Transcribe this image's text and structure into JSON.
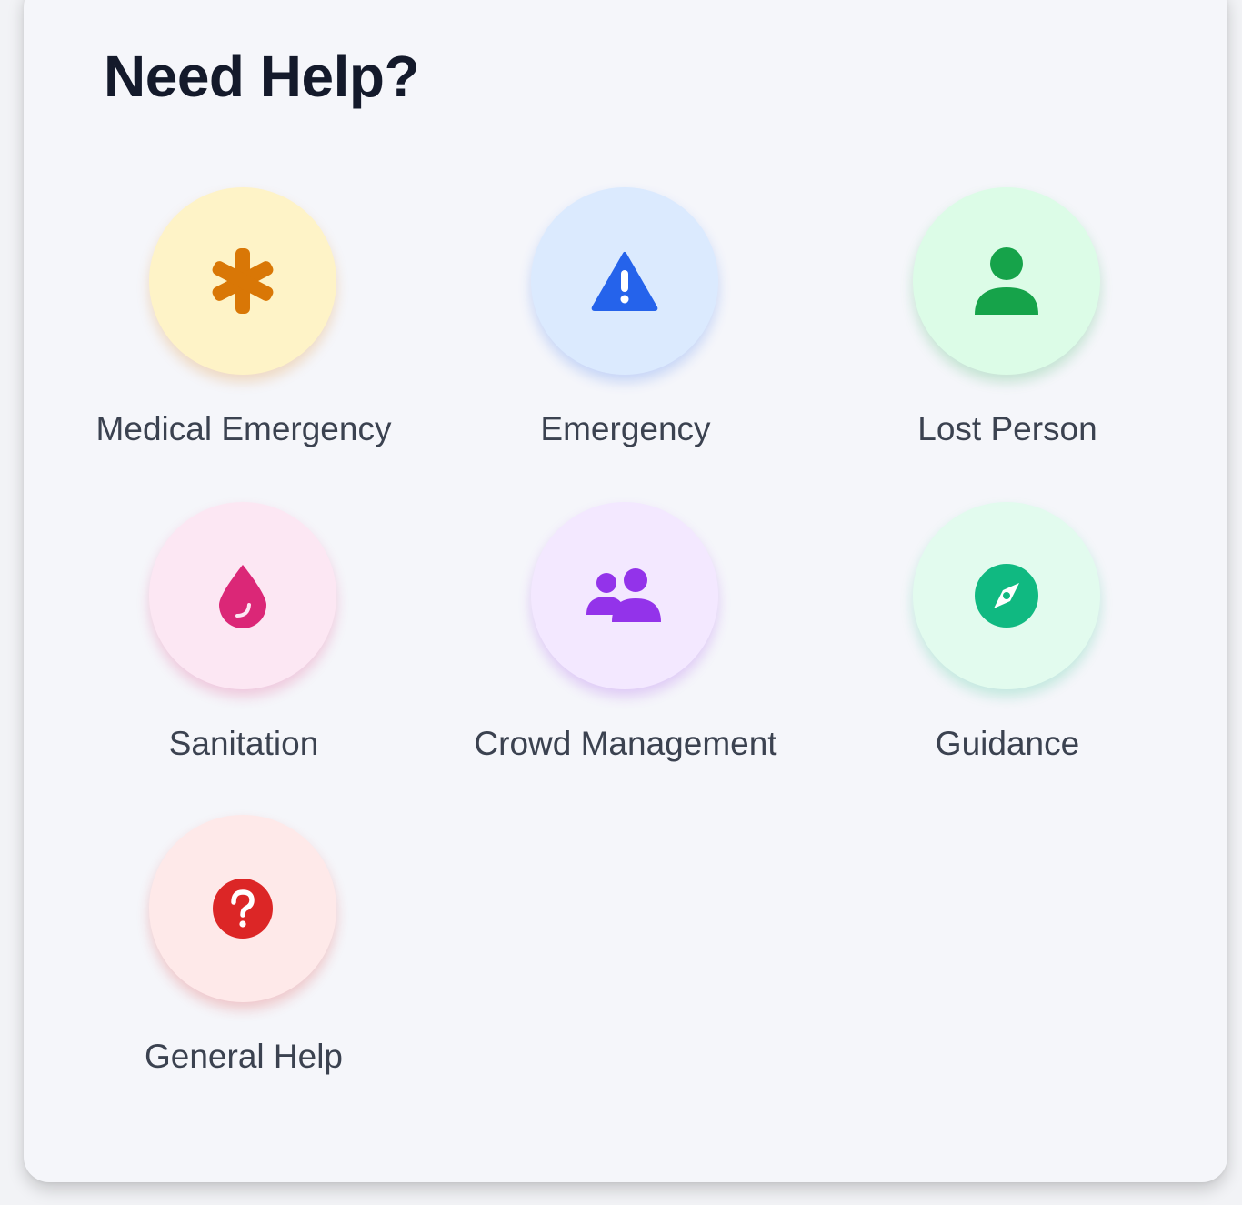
{
  "panel": {
    "title": "Need Help?"
  },
  "help_options": [
    {
      "label": "Medical Emergency",
      "icon": "medical-asterisk-icon",
      "icon_color": "#d97706",
      "bg_color": "#fef3c7"
    },
    {
      "label": "Emergency",
      "icon": "warning-triangle-icon",
      "icon_color": "#2563eb",
      "bg_color": "#dbeafe"
    },
    {
      "label": "Lost Person",
      "icon": "person-icon",
      "icon_color": "#16a34a",
      "bg_color": "#dcfce7"
    },
    {
      "label": "Sanitation",
      "icon": "water-drop-icon",
      "icon_color": "#db2777",
      "bg_color": "#fce7f3"
    },
    {
      "label": "Crowd Management",
      "icon": "people-group-icon",
      "icon_color": "#9333ea",
      "bg_color": "#f3e8ff"
    },
    {
      "label": "Guidance",
      "icon": "compass-icon",
      "icon_color": "#10b981",
      "bg_color": "#e2fbee"
    },
    {
      "label": "General Help",
      "icon": "question-circle-icon",
      "icon_color": "#dc2626",
      "bg_color": "#fee9e9"
    }
  ]
}
